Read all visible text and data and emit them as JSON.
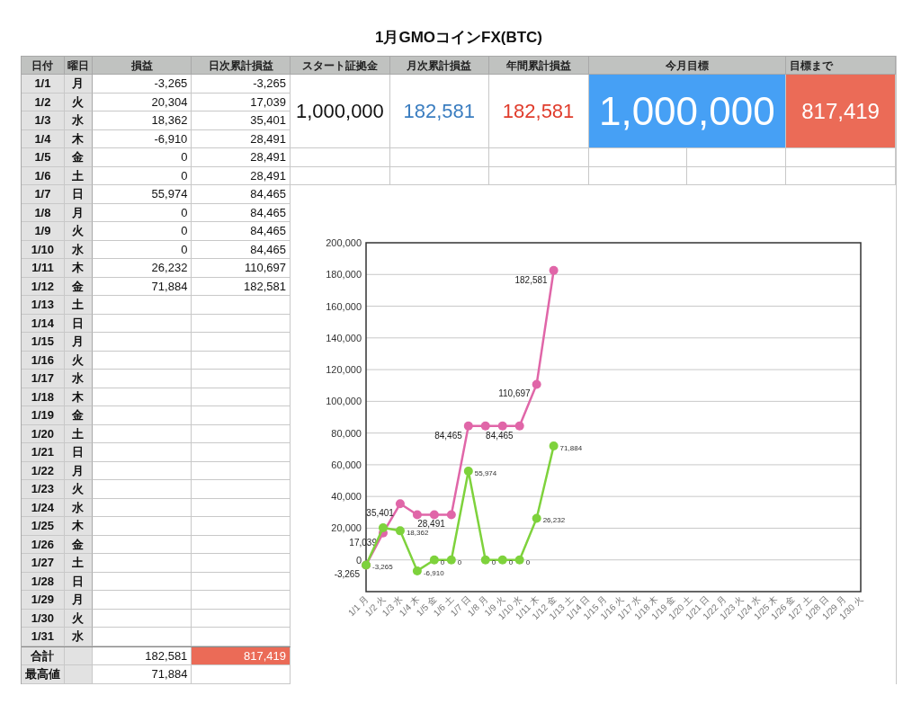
{
  "title": "1月GMOコインFX(BTC)",
  "ledger": {
    "columns": [
      "日付",
      "曜日",
      "損益",
      "日次累計損益"
    ],
    "rows": [
      {
        "date": "1/1",
        "weekday": "月",
        "pl": "-3,265",
        "cumulative": "-3,265"
      },
      {
        "date": "1/2",
        "weekday": "火",
        "pl": "20,304",
        "cumulative": "17,039"
      },
      {
        "date": "1/3",
        "weekday": "水",
        "pl": "18,362",
        "cumulative": "35,401"
      },
      {
        "date": "1/4",
        "weekday": "木",
        "pl": "-6,910",
        "cumulative": "28,491"
      },
      {
        "date": "1/5",
        "weekday": "金",
        "pl": "0",
        "cumulative": "28,491"
      },
      {
        "date": "1/6",
        "weekday": "土",
        "pl": "0",
        "cumulative": "28,491"
      },
      {
        "date": "1/7",
        "weekday": "日",
        "pl": "55,974",
        "cumulative": "84,465"
      },
      {
        "date": "1/8",
        "weekday": "月",
        "pl": "0",
        "cumulative": "84,465"
      },
      {
        "date": "1/9",
        "weekday": "火",
        "pl": "0",
        "cumulative": "84,465"
      },
      {
        "date": "1/10",
        "weekday": "水",
        "pl": "0",
        "cumulative": "84,465"
      },
      {
        "date": "1/11",
        "weekday": "木",
        "pl": "26,232",
        "cumulative": "110,697"
      },
      {
        "date": "1/12",
        "weekday": "金",
        "pl": "71,884",
        "cumulative": "182,581"
      },
      {
        "date": "1/13",
        "weekday": "土"
      },
      {
        "date": "1/14",
        "weekday": "日"
      },
      {
        "date": "1/15",
        "weekday": "月"
      },
      {
        "date": "1/16",
        "weekday": "火"
      },
      {
        "date": "1/17",
        "weekday": "水"
      },
      {
        "date": "1/18",
        "weekday": "木"
      },
      {
        "date": "1/19",
        "weekday": "金"
      },
      {
        "date": "1/20",
        "weekday": "土"
      },
      {
        "date": "1/21",
        "weekday": "日"
      },
      {
        "date": "1/22",
        "weekday": "月"
      },
      {
        "date": "1/23",
        "weekday": "火"
      },
      {
        "date": "1/24",
        "weekday": "水"
      },
      {
        "date": "1/25",
        "weekday": "木"
      },
      {
        "date": "1/26",
        "weekday": "金"
      },
      {
        "date": "1/27",
        "weekday": "土"
      },
      {
        "date": "1/28",
        "weekday": "日"
      },
      {
        "date": "1/29",
        "weekday": "月"
      },
      {
        "date": "1/30",
        "weekday": "火"
      },
      {
        "date": "1/31",
        "weekday": "水"
      }
    ],
    "total": {
      "label": "合計",
      "pl": "182,581",
      "cumulative": "817,419",
      "color": "#eb6b57"
    },
    "max": {
      "label": "最高値",
      "pl": "71,884"
    }
  },
  "summary": [
    {
      "heading": "スタート証拠金",
      "value": "1,000,000",
      "kind": "text",
      "color": "#111111"
    },
    {
      "heading": "月次累計損益",
      "value": "182,581",
      "kind": "text",
      "color": "#3a7dc0"
    },
    {
      "heading": "年間累計損益",
      "value": "182,581",
      "kind": "text",
      "color": "#e03c2c"
    },
    {
      "heading": "今月目標",
      "value": "1,000,000",
      "kind": "banner",
      "color": "#46a0f5"
    },
    {
      "heading": "目標まで",
      "value": "817,419",
      "kind": "fill",
      "color": "#eb6b57"
    }
  ],
  "chart": {
    "chart_data": {
      "type": "line",
      "categories": [
        "1/1 月",
        "1/2 火",
        "1/3 水",
        "1/4 木",
        "1/5 金",
        "1/6 土",
        "1/7 日",
        "1/8 月",
        "1/9 火",
        "1/10 水",
        "1/11 木",
        "1/12 金",
        "1/13 土",
        "1/14 日",
        "1/15 月",
        "1/16 火",
        "1/17 水",
        "1/18 木",
        "1/19 金",
        "1/20 土",
        "1/21 日",
        "1/22 月",
        "1/23 火",
        "1/24 水",
        "1/25 木",
        "1/26 金",
        "1/27 土",
        "1/28 日",
        "1/29 月",
        "1/30 火"
      ],
      "ylim": [
        -20000,
        200000
      ],
      "grid": true,
      "yticks": [
        {
          "value": 0,
          "label": "0"
        },
        {
          "value": 20000,
          "label": "20,000"
        },
        {
          "value": 40000,
          "label": "40,000"
        },
        {
          "value": 60000,
          "label": "60,000"
        },
        {
          "value": 80000,
          "label": "80,000"
        },
        {
          "value": 100000,
          "label": "100,000"
        },
        {
          "value": 120000,
          "label": "120,000"
        },
        {
          "value": 140000,
          "label": "140,000"
        },
        {
          "value": 160000,
          "label": "160,000"
        },
        {
          "value": 180000,
          "label": "180,000"
        },
        {
          "value": 200000,
          "label": "200,000"
        }
      ],
      "series": [
        {
          "color": "#e066a8",
          "marker": "circle",
          "values": [
            -3265,
            17039,
            35401,
            28491,
            28491,
            28491,
            84465,
            84465,
            84465,
            84465,
            110697,
            182581,
            null,
            null,
            null,
            null,
            null,
            null,
            null,
            null,
            null,
            null,
            null,
            null,
            null,
            null,
            null,
            null,
            null,
            null
          ],
          "value_labels": [
            "-3,265",
            "17,039",
            "35,401",
            null,
            null,
            "28,491",
            "84,465",
            null,
            null,
            "84,465",
            "110,697",
            "182,581",
            null,
            null,
            null,
            null,
            null,
            null,
            null,
            null,
            null,
            null,
            null,
            null,
            null,
            null,
            null,
            null,
            null,
            null
          ]
        },
        {
          "color": "#7ed23c",
          "marker": "circle",
          "values": [
            -3265,
            20304,
            18362,
            -6910,
            0,
            0,
            55974,
            0,
            0,
            0,
            26232,
            71884,
            null,
            null,
            null,
            null,
            null,
            null,
            null,
            null,
            null,
            null,
            null,
            null,
            null,
            null,
            null,
            null,
            null,
            null
          ],
          "value_labels": [
            "-3,265",
            null,
            "18,362",
            "-6,910",
            "0",
            "0",
            "55,974",
            "0",
            "0",
            "0",
            "26,232",
            "71,884",
            null,
            null,
            null,
            null,
            null,
            null,
            null,
            null,
            null,
            null,
            null,
            null,
            null,
            null,
            null,
            null,
            null,
            null
          ]
        }
      ]
    }
  }
}
